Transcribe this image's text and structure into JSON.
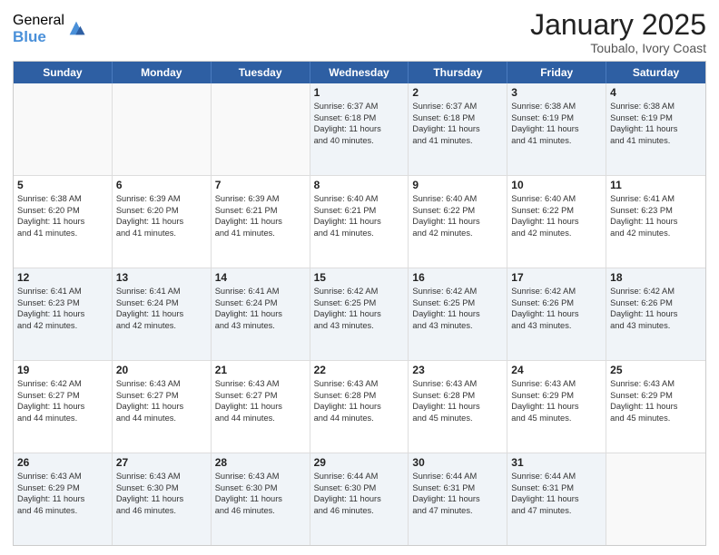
{
  "header": {
    "logo_general": "General",
    "logo_blue": "Blue",
    "month_title": "January 2025",
    "location": "Toubalo, Ivory Coast"
  },
  "days_of_week": [
    "Sunday",
    "Monday",
    "Tuesday",
    "Wednesday",
    "Thursday",
    "Friday",
    "Saturday"
  ],
  "weeks": [
    [
      {
        "day": "",
        "sunrise": "",
        "sunset": "",
        "daylight": ""
      },
      {
        "day": "",
        "sunrise": "",
        "sunset": "",
        "daylight": ""
      },
      {
        "day": "",
        "sunrise": "",
        "sunset": "",
        "daylight": ""
      },
      {
        "day": "1",
        "sunrise": "Sunrise: 6:37 AM",
        "sunset": "Sunset: 6:18 PM",
        "daylight": "Daylight: 11 hours and 40 minutes."
      },
      {
        "day": "2",
        "sunrise": "Sunrise: 6:37 AM",
        "sunset": "Sunset: 6:18 PM",
        "daylight": "Daylight: 11 hours and 41 minutes."
      },
      {
        "day": "3",
        "sunrise": "Sunrise: 6:38 AM",
        "sunset": "Sunset: 6:19 PM",
        "daylight": "Daylight: 11 hours and 41 minutes."
      },
      {
        "day": "4",
        "sunrise": "Sunrise: 6:38 AM",
        "sunset": "Sunset: 6:19 PM",
        "daylight": "Daylight: 11 hours and 41 minutes."
      }
    ],
    [
      {
        "day": "5",
        "sunrise": "Sunrise: 6:38 AM",
        "sunset": "Sunset: 6:20 PM",
        "daylight": "Daylight: 11 hours and 41 minutes."
      },
      {
        "day": "6",
        "sunrise": "Sunrise: 6:39 AM",
        "sunset": "Sunset: 6:20 PM",
        "daylight": "Daylight: 11 hours and 41 minutes."
      },
      {
        "day": "7",
        "sunrise": "Sunrise: 6:39 AM",
        "sunset": "Sunset: 6:21 PM",
        "daylight": "Daylight: 11 hours and 41 minutes."
      },
      {
        "day": "8",
        "sunrise": "Sunrise: 6:40 AM",
        "sunset": "Sunset: 6:21 PM",
        "daylight": "Daylight: 11 hours and 41 minutes."
      },
      {
        "day": "9",
        "sunrise": "Sunrise: 6:40 AM",
        "sunset": "Sunset: 6:22 PM",
        "daylight": "Daylight: 11 hours and 42 minutes."
      },
      {
        "day": "10",
        "sunrise": "Sunrise: 6:40 AM",
        "sunset": "Sunset: 6:22 PM",
        "daylight": "Daylight: 11 hours and 42 minutes."
      },
      {
        "day": "11",
        "sunrise": "Sunrise: 6:41 AM",
        "sunset": "Sunset: 6:23 PM",
        "daylight": "Daylight: 11 hours and 42 minutes."
      }
    ],
    [
      {
        "day": "12",
        "sunrise": "Sunrise: 6:41 AM",
        "sunset": "Sunset: 6:23 PM",
        "daylight": "Daylight: 11 hours and 42 minutes."
      },
      {
        "day": "13",
        "sunrise": "Sunrise: 6:41 AM",
        "sunset": "Sunset: 6:24 PM",
        "daylight": "Daylight: 11 hours and 42 minutes."
      },
      {
        "day": "14",
        "sunrise": "Sunrise: 6:41 AM",
        "sunset": "Sunset: 6:24 PM",
        "daylight": "Daylight: 11 hours and 43 minutes."
      },
      {
        "day": "15",
        "sunrise": "Sunrise: 6:42 AM",
        "sunset": "Sunset: 6:25 PM",
        "daylight": "Daylight: 11 hours and 43 minutes."
      },
      {
        "day": "16",
        "sunrise": "Sunrise: 6:42 AM",
        "sunset": "Sunset: 6:25 PM",
        "daylight": "Daylight: 11 hours and 43 minutes."
      },
      {
        "day": "17",
        "sunrise": "Sunrise: 6:42 AM",
        "sunset": "Sunset: 6:26 PM",
        "daylight": "Daylight: 11 hours and 43 minutes."
      },
      {
        "day": "18",
        "sunrise": "Sunrise: 6:42 AM",
        "sunset": "Sunset: 6:26 PM",
        "daylight": "Daylight: 11 hours and 43 minutes."
      }
    ],
    [
      {
        "day": "19",
        "sunrise": "Sunrise: 6:42 AM",
        "sunset": "Sunset: 6:27 PM",
        "daylight": "Daylight: 11 hours and 44 minutes."
      },
      {
        "day": "20",
        "sunrise": "Sunrise: 6:43 AM",
        "sunset": "Sunset: 6:27 PM",
        "daylight": "Daylight: 11 hours and 44 minutes."
      },
      {
        "day": "21",
        "sunrise": "Sunrise: 6:43 AM",
        "sunset": "Sunset: 6:27 PM",
        "daylight": "Daylight: 11 hours and 44 minutes."
      },
      {
        "day": "22",
        "sunrise": "Sunrise: 6:43 AM",
        "sunset": "Sunset: 6:28 PM",
        "daylight": "Daylight: 11 hours and 44 minutes."
      },
      {
        "day": "23",
        "sunrise": "Sunrise: 6:43 AM",
        "sunset": "Sunset: 6:28 PM",
        "daylight": "Daylight: 11 hours and 45 minutes."
      },
      {
        "day": "24",
        "sunrise": "Sunrise: 6:43 AM",
        "sunset": "Sunset: 6:29 PM",
        "daylight": "Daylight: 11 hours and 45 minutes."
      },
      {
        "day": "25",
        "sunrise": "Sunrise: 6:43 AM",
        "sunset": "Sunset: 6:29 PM",
        "daylight": "Daylight: 11 hours and 45 minutes."
      }
    ],
    [
      {
        "day": "26",
        "sunrise": "Sunrise: 6:43 AM",
        "sunset": "Sunset: 6:29 PM",
        "daylight": "Daylight: 11 hours and 46 minutes."
      },
      {
        "day": "27",
        "sunrise": "Sunrise: 6:43 AM",
        "sunset": "Sunset: 6:30 PM",
        "daylight": "Daylight: 11 hours and 46 minutes."
      },
      {
        "day": "28",
        "sunrise": "Sunrise: 6:43 AM",
        "sunset": "Sunset: 6:30 PM",
        "daylight": "Daylight: 11 hours and 46 minutes."
      },
      {
        "day": "29",
        "sunrise": "Sunrise: 6:44 AM",
        "sunset": "Sunset: 6:30 PM",
        "daylight": "Daylight: 11 hours and 46 minutes."
      },
      {
        "day": "30",
        "sunrise": "Sunrise: 6:44 AM",
        "sunset": "Sunset: 6:31 PM",
        "daylight": "Daylight: 11 hours and 47 minutes."
      },
      {
        "day": "31",
        "sunrise": "Sunrise: 6:44 AM",
        "sunset": "Sunset: 6:31 PM",
        "daylight": "Daylight: 11 hours and 47 minutes."
      },
      {
        "day": "",
        "sunrise": "",
        "sunset": "",
        "daylight": ""
      }
    ]
  ],
  "alt_rows": [
    0,
    2,
    4
  ]
}
